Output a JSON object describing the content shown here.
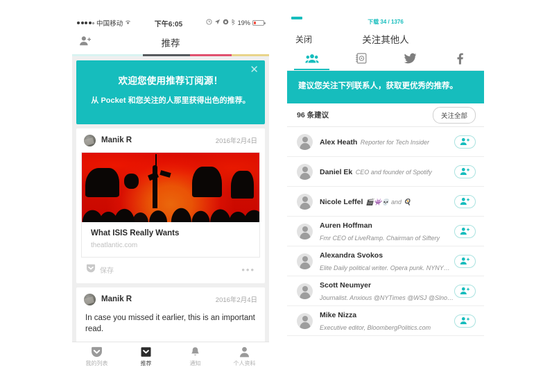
{
  "colors": {
    "teal": "#16bdbd",
    "teal_border": "#a9e3e0",
    "battery_red": "#f04a3c",
    "strip_teal": "#16bdbd",
    "strip_gray": "#565a5e",
    "strip_pink": "#e0516f",
    "strip_yellow": "#e8d48a"
  },
  "left_phone": {
    "statusbar": {
      "carrier": "中国移动",
      "wifi_icon": "wifi-icon",
      "time": "下午6:05",
      "icons": [
        "alarm-icon",
        "location-arrow-icon",
        "rotation-lock-icon",
        "bluetooth-icon"
      ],
      "battery_pct": "19%"
    },
    "navbar": {
      "title": "推荐",
      "left_icon": "add-person-icon"
    },
    "welcome_banner": {
      "heading": "欢迎您使用推荐订阅源！",
      "body": "从 Pocket 和您关注的人那里获得出色的推荐。",
      "close_icon": "close-icon"
    },
    "cards": [
      {
        "author": "Manik R",
        "date": "2016年2月4日",
        "thumbnail": "isis-crowd-red-image",
        "title": "What ISIS Really Wants",
        "domain": "theatlantic.com",
        "save_label": "保存",
        "save_icon": "pocket-icon",
        "more_icon": "more-dots-icon"
      },
      {
        "author": "Manik R",
        "date": "2016年2月4日",
        "text": "In case you missed it earlier, this is an important read."
      }
    ],
    "tabbar": [
      {
        "label": "我的列表",
        "icon": "pocket-outline-icon",
        "active": false
      },
      {
        "label": "推荐",
        "icon": "pocket-filled-icon",
        "active": true
      },
      {
        "label": "通知",
        "icon": "bell-icon",
        "active": false
      },
      {
        "label": "个人资料",
        "icon": "person-icon",
        "active": false
      }
    ]
  },
  "right_phone": {
    "statusbar": {
      "download_label": "下载 34 / 1376"
    },
    "navbar": {
      "close_label": "关闭",
      "title": "关注其他人"
    },
    "segments": [
      {
        "icon": "people-group-icon",
        "active": true
      },
      {
        "icon": "contacts-book-icon",
        "active": false
      },
      {
        "icon": "twitter-bird-icon",
        "active": false
      },
      {
        "icon": "facebook-f-icon",
        "active": false
      }
    ],
    "hint_banner": {
      "text": "建议您关注下列联系人，获取更优秀的推荐。"
    },
    "suggestions_header": {
      "count_label": "96 条建议",
      "follow_all_label": "关注全部"
    },
    "people": [
      {
        "name": "Alex Heath",
        "desc": "Reporter for Tech Insider",
        "follow_icon": "add-person-icon"
      },
      {
        "name": "Daniel Ek",
        "desc": "CEO and founder of Spotify",
        "follow_icon": "add-person-icon"
      },
      {
        "name": "Nicole Leffel",
        "desc": "🎬👾💀 and 🍳",
        "follow_icon": "add-person-icon"
      },
      {
        "name": "Auren Hoffman",
        "desc": "Fmr CEO of LiveRamp.  Chairman of Siftery",
        "follow_icon": "add-person-icon"
      },
      {
        "name": "Alexandra Svokos",
        "desc": "Elite Daily political writer. Opera punk. NYNY…",
        "follow_icon": "add-person-icon"
      },
      {
        "name": "Scott Neumyer",
        "desc": "Journalist. Anxious @NYTimes @WSJ @Slno…",
        "follow_icon": "add-person-icon"
      },
      {
        "name": "Mike Nizza",
        "desc": "Executive editor, BloombergPolitics.com",
        "follow_icon": "add-person-icon"
      }
    ]
  }
}
